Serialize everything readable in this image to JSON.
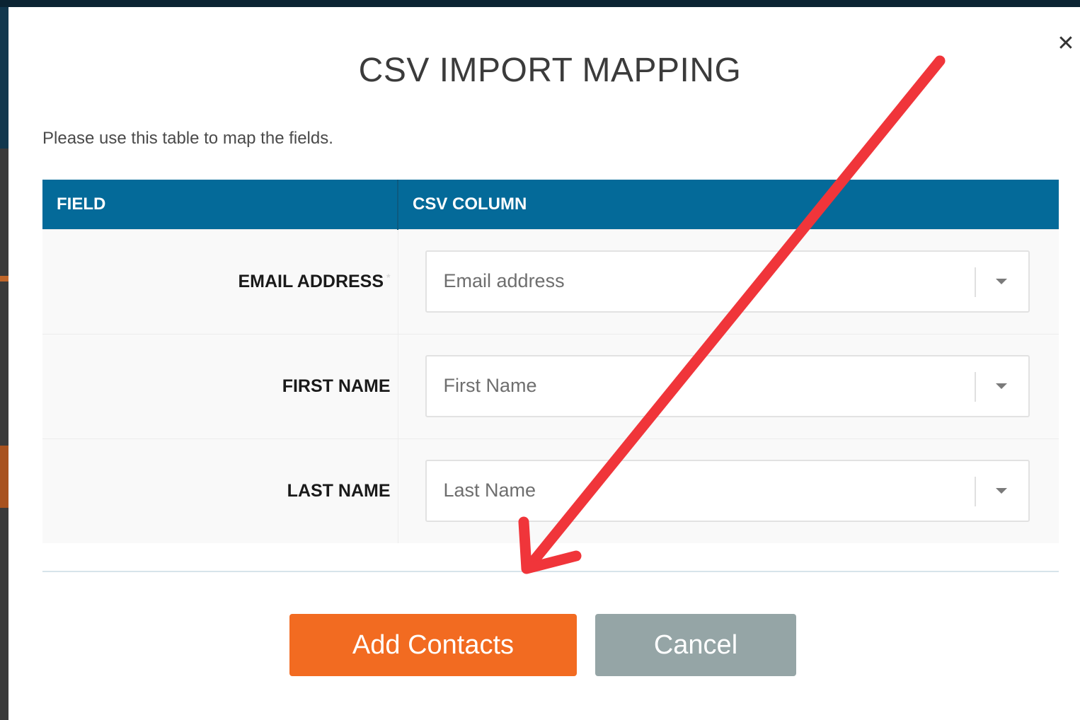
{
  "modal": {
    "title": "CSV IMPORT MAPPING",
    "close_icon": "close-icon",
    "instructions": "Please use this table to map the fields.",
    "table": {
      "headers": [
        "FIELD",
        "CSV COLUMN"
      ],
      "rows": [
        {
          "field": "EMAIL ADDRESS",
          "required_mark": "*",
          "select_value": "Email address"
        },
        {
          "field": "FIRST NAME",
          "select_value": "First Name"
        },
        {
          "field": "LAST NAME",
          "select_value": "Last Name"
        }
      ]
    },
    "buttons": {
      "add_label": "Add Contacts",
      "cancel_label": "Cancel"
    }
  },
  "colors": {
    "header_bg": "#046a99",
    "primary_button": "#f26b21",
    "secondary_button": "#95a5a6",
    "annotation_arrow": "#f0353a"
  },
  "annotation": {
    "type": "arrow",
    "points_to": "add-contacts-button"
  }
}
